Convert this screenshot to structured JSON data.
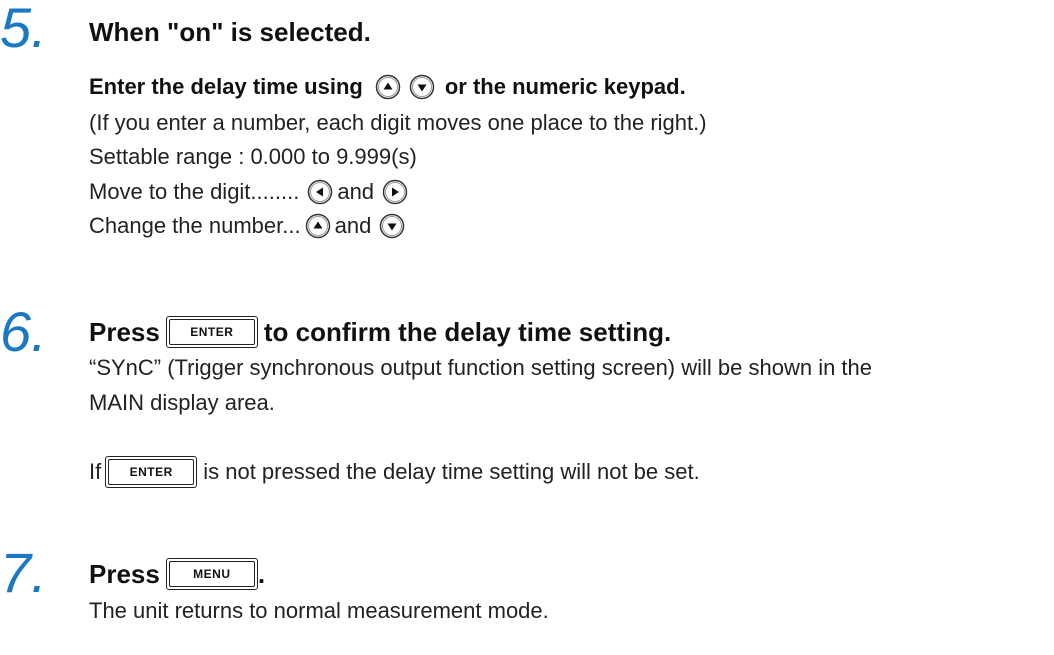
{
  "step5": {
    "number": "5.",
    "heading": "When \"on\" is selected.",
    "instruction_pre": "Enter the delay time using",
    "instruction_post": "or the numeric keypad.",
    "note": "(If you enter a number, each digit moves one place to the right.)",
    "range": "Settable range : 0.000 to 9.999(s)",
    "move_label": "Move to the digit........",
    "change_label": "Change the number...",
    "and1": "and",
    "and2": "and"
  },
  "step6": {
    "number": "6.",
    "press": "Press",
    "heading_post": "to confirm the delay time setting.",
    "line1": "“SYnC” (Trigger synchronous output function setting screen) will be shown in the",
    "line2": "MAIN display area.",
    "if_pre": "If",
    "if_post": "is not pressed the delay time setting will not be set."
  },
  "step7": {
    "number": "7.",
    "press": "Press",
    "period": ".",
    "line1": "The unit returns to normal measurement mode."
  },
  "keys": {
    "enter": "ENTER",
    "menu": "MENU"
  },
  "icons": {
    "up": "up-arrow-button-icon",
    "down": "down-arrow-button-icon",
    "left": "left-arrow-button-icon",
    "right": "right-arrow-button-icon"
  }
}
